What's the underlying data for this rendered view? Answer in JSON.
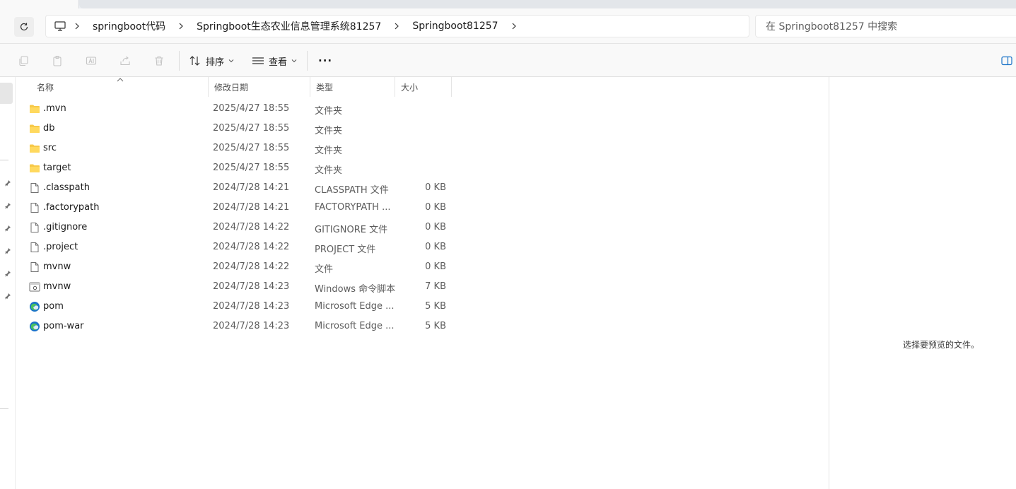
{
  "breadcrumb": {
    "items": [
      "springboot代码",
      "Springboot生态农业信息管理系统81257",
      "Springboot81257"
    ]
  },
  "search": {
    "placeholder": "在 Springboot81257 中搜索"
  },
  "toolbar": {
    "sort_label": "排序",
    "view_label": "查看",
    "more_label": "···"
  },
  "columns": {
    "name": "名称",
    "date": "修改日期",
    "type": "类型",
    "size": "大小"
  },
  "files": [
    {
      "name": ".mvn",
      "date": "2025/4/27 18:55",
      "type": "文件夹",
      "size": "",
      "icon": "folder-icon"
    },
    {
      "name": "db",
      "date": "2025/4/27 18:55",
      "type": "文件夹",
      "size": "",
      "icon": "folder-icon"
    },
    {
      "name": "src",
      "date": "2025/4/27 18:55",
      "type": "文件夹",
      "size": "",
      "icon": "folder-icon"
    },
    {
      "name": "target",
      "date": "2025/4/27 18:55",
      "type": "文件夹",
      "size": "",
      "icon": "folder-icon"
    },
    {
      "name": ".classpath",
      "date": "2024/7/28 14:21",
      "type": "CLASSPATH 文件",
      "size": "0 KB",
      "icon": "file-icon"
    },
    {
      "name": ".factorypath",
      "date": "2024/7/28 14:21",
      "type": "FACTORYPATH ...",
      "size": "0 KB",
      "icon": "file-icon"
    },
    {
      "name": ".gitignore",
      "date": "2024/7/28 14:22",
      "type": "GITIGNORE 文件",
      "size": "0 KB",
      "icon": "file-icon"
    },
    {
      "name": ".project",
      "date": "2024/7/28 14:22",
      "type": "PROJECT 文件",
      "size": "0 KB",
      "icon": "file-icon"
    },
    {
      "name": "mvnw",
      "date": "2024/7/28 14:22",
      "type": "文件",
      "size": "0 KB",
      "icon": "file-icon"
    },
    {
      "name": "mvnw",
      "date": "2024/7/28 14:23",
      "type": "Windows 命令脚本",
      "size": "7 KB",
      "icon": "script-icon"
    },
    {
      "name": "pom",
      "date": "2024/7/28 14:23",
      "type": "Microsoft Edge ...",
      "size": "5 KB",
      "icon": "edge-icon"
    },
    {
      "name": "pom-war",
      "date": "2024/7/28 14:23",
      "type": "Microsoft Edge ...",
      "size": "5 KB",
      "icon": "edge-icon"
    }
  ],
  "preview": {
    "message": "选择要预览的文件。"
  },
  "colors": {
    "folder": "#f7c948",
    "edge_blue": "#1a73c8",
    "edge_green": "#4cc35e"
  }
}
